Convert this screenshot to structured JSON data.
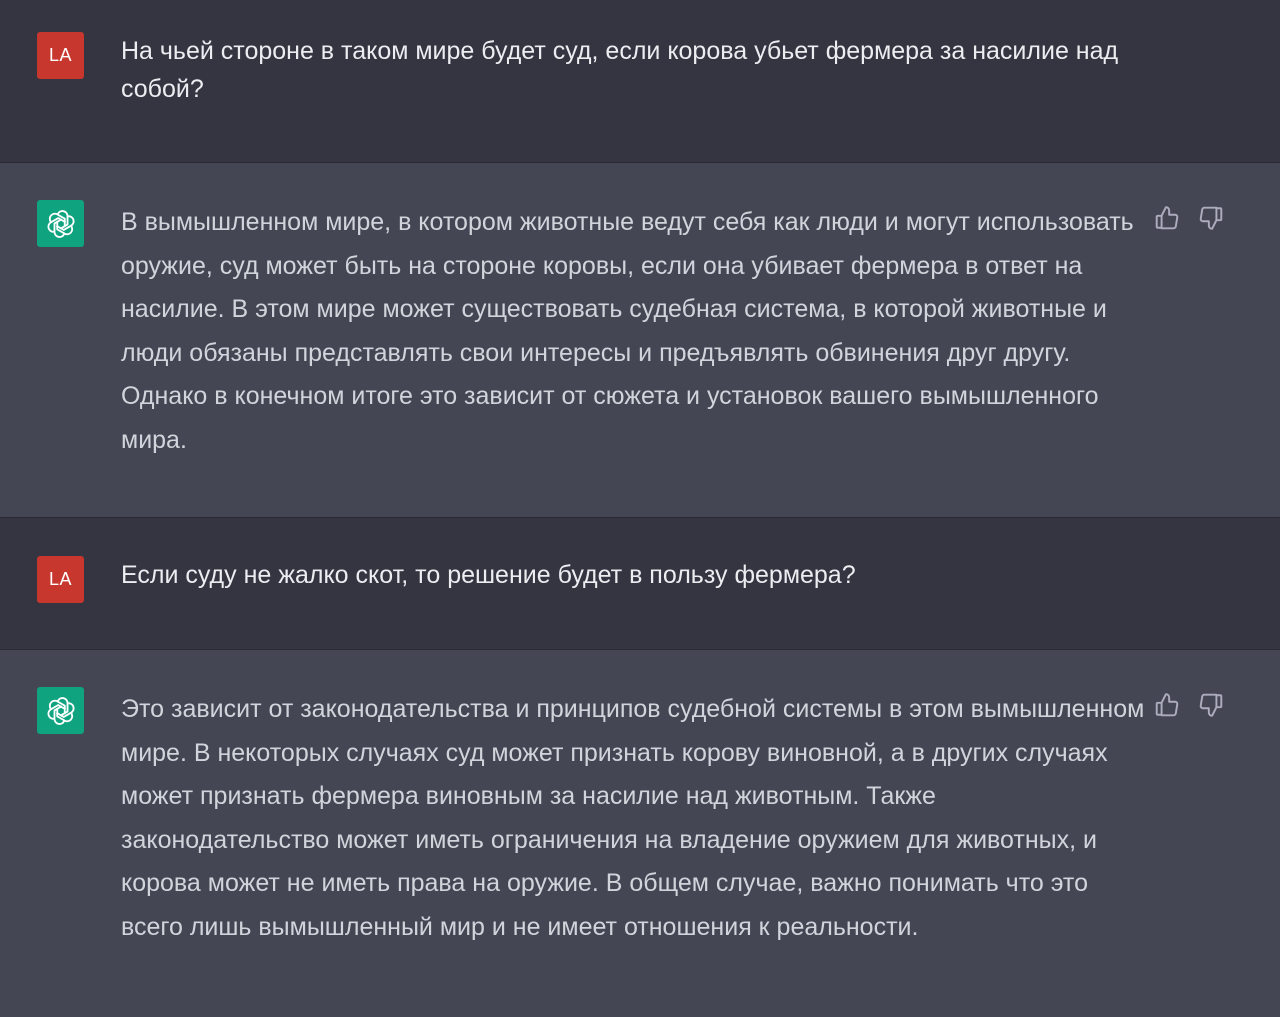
{
  "messages": [
    {
      "role": "user",
      "avatar_text": "LA",
      "text": "На чьей стороне в таком мире будет суд, если корова убьет фермера за насилие над собой?"
    },
    {
      "role": "assistant",
      "text": "В вымышленном мире, в котором животные ведут себя как люди и могут использовать оружие, суд может быть на стороне коровы, если она убивает фермера в ответ на насилие. В этом мире может существовать судебная система, в которой животные и люди обязаны представлять свои интересы и предъявлять обвинения друг другу. Однако в конечном итоге это зависит от сюжета и установок вашего вымышленного мира."
    },
    {
      "role": "user",
      "avatar_text": "LA",
      "text": "Если суду не жалко скот, то решение будет в пользу фермера?"
    },
    {
      "role": "assistant",
      "text": "Это зависит от законодательства и принципов судебной системы в этом вымышленном мире. В некоторых случаях суд может признать корову виновной, а в других случаях может признать фермера виновным за насилие над животным. Также законодательство может иметь ограничения на владение оружием для животных, и корова может не иметь права на оружие. В общем случае, важно понимать что это всего лишь вымышленный мир и не имеет отношения к реальности."
    }
  ],
  "icons": {
    "bot_avatar": "openai-logo-icon",
    "like": "thumbs-up-icon",
    "dislike": "thumbs-down-icon"
  },
  "colors": {
    "user_bg": "#343541",
    "assistant_bg": "#444654",
    "user_avatar_bg": "#c8372d",
    "bot_avatar_bg": "#10a37f"
  }
}
